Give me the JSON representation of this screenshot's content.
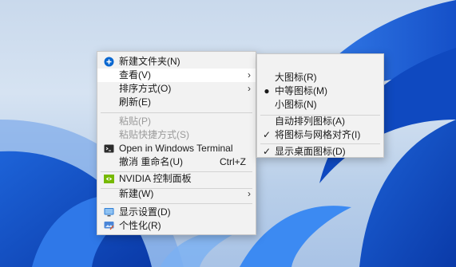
{
  "colors": {
    "accent": "#0067c0",
    "menu_bg": "#f2f2f2",
    "text": "#1a1a1a",
    "disabled": "#9a9a9a"
  },
  "context_menu": {
    "new_folder": "新建文件夹(N)",
    "view": "查看(V)",
    "sort_by": "排序方式(O)",
    "refresh": "刷新(E)",
    "paste": "粘贴(P)",
    "paste_shortcut": "粘贴快捷方式(S)",
    "open_terminal": "Open in Windows Terminal",
    "undo_rename": "撤消 重命名(U)",
    "undo_shortcut": "Ctrl+Z",
    "nvidia": "NVIDIA 控制面板",
    "new": "新建(W)",
    "display_settings": "显示设置(D)",
    "personalize": "个性化(R)"
  },
  "view_submenu": {
    "large_icons": "大图标(R)",
    "medium_icons": "中等图标(M)",
    "small_icons": "小图标(N)",
    "auto_arrange": "自动排列图标(A)",
    "align_grid": "将图标与网格对齐(I)",
    "show_desktop_icons": "显示桌面图标(D)"
  },
  "icons": [
    "new-folder-icon",
    "terminal-icon",
    "nvidia-icon",
    "display-settings-icon",
    "personalize-icon",
    "radio-dot-icon",
    "checkmark-icon",
    "chevron-right-icon"
  ]
}
